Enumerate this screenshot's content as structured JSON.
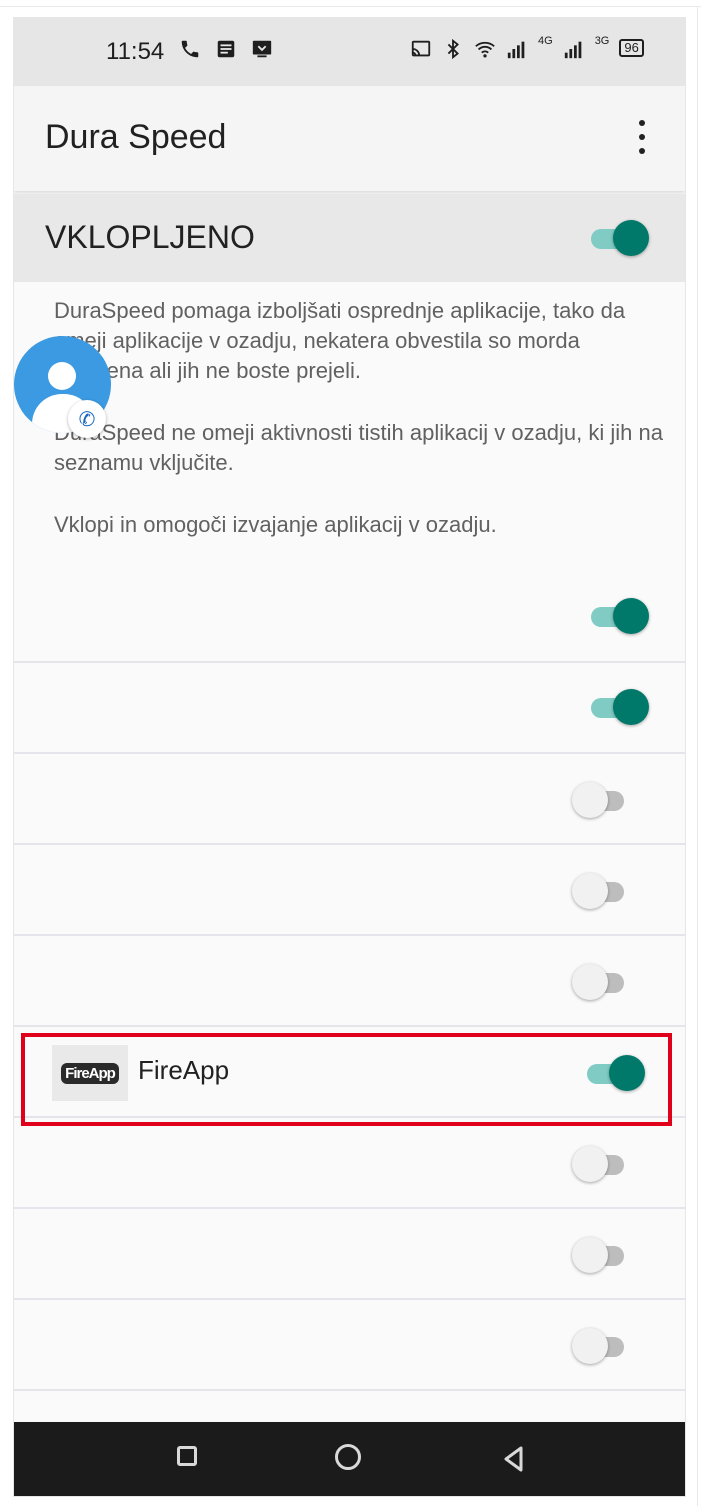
{
  "status_bar": {
    "time": "11:54",
    "battery": "96",
    "network_4g": "4G",
    "network_3g": "3G",
    "left_icons": [
      "phone-call-icon",
      "message-icon",
      "screen-download-icon"
    ],
    "right_icons": [
      "cast-icon",
      "bluetooth-icon",
      "wifi-icon",
      "signal-4g-icon",
      "signal-3g-icon",
      "battery-icon"
    ]
  },
  "app_bar": {
    "title": "Dura Speed",
    "overflow_icon": "more-vert-icon"
  },
  "master": {
    "label": "VKLOPLJENO",
    "enabled": true
  },
  "description": {
    "p1": "DuraSpeed pomaga izboljšati osprednje aplikacije, tako da omeji aplikacije v ozadju, nekatera obvestila so morda odložena ali jih ne boste prejeli.",
    "p2": "DuraSpeed ne omeji aktivnosti tistih aplikacij v ozadju, ki jih na seznamu vključite.",
    "p3": "Vklopi in omogoči izvajanje aplikacij v ozadju."
  },
  "apps": [
    {
      "name": "",
      "enabled": true
    },
    {
      "name": "",
      "enabled": true
    },
    {
      "name": "",
      "enabled": false
    },
    {
      "name": "",
      "enabled": false
    },
    {
      "name": "",
      "enabled": false
    },
    {
      "name": "FireApp",
      "enabled": true,
      "highlighted": true
    },
    {
      "name": "",
      "enabled": false
    },
    {
      "name": "",
      "enabled": false
    },
    {
      "name": "",
      "enabled": false
    }
  ],
  "fireapp_logo_text": "FireApp",
  "colors": {
    "toggle_on_thumb": "#00796b",
    "toggle_on_track": "#80cbc4",
    "toggle_off_thumb": "#f1f1f1",
    "toggle_off_track": "#bdbdbd",
    "highlight": "#e0001b"
  },
  "navigation": [
    "recents-button",
    "home-button",
    "back-button"
  ]
}
